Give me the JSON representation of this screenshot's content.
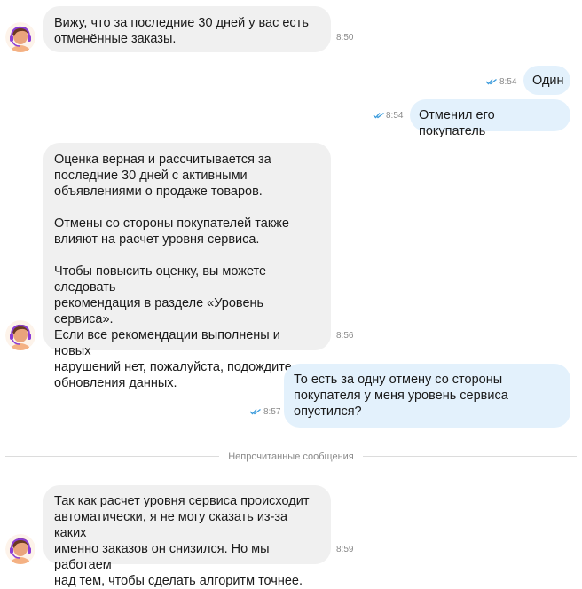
{
  "messages": [
    {
      "author": "agent",
      "text": "Вижу, что за последние 30 дней у вас есть\nотменённые заказы.",
      "time": "8:50"
    },
    {
      "author": "user",
      "text": "Один",
      "time": "8:54"
    },
    {
      "author": "user",
      "text": "Отменил его покупатель",
      "time": "8:54"
    },
    {
      "author": "agent",
      "text": "Оценка верная и рассчитывается за\nпоследние 30 дней с активными\nобъявлениями о продаже товаров.\n\nОтмены со стороны покупателей также\nвлияют на расчет уровня сервиса.\n\nЧтобы повысить оценку, вы можете следовать\nрекомендация в разделе «Уровень сервиса».\nЕсли все рекомендации выполнены и новых\nнарушений нет, пожалуйста, подождите\nобновления данных.",
      "time": "8:56"
    },
    {
      "author": "user",
      "text": "То есть за одну отмену со стороны\nпокупателя у меня уровень сервиса\nопустился?",
      "time": "8:57"
    },
    {
      "author": "agent",
      "text": "Так как расчет уровня сервиса происходит\nавтоматически, я не могу сказать из-за каких\nименно заказов он снизился. Но мы работаем\nнад тем, чтобы сделать алгоритм точнее.",
      "time": "8:59"
    }
  ],
  "divider": {
    "label": "Непрочитанные сообщения"
  },
  "colors": {
    "incoming_bubble": "#f0f0f0",
    "outgoing_bubble": "#e3f1fc",
    "read_check": "#3b9bdc",
    "time": "#8a8a8a",
    "avatar_headset": "#8b3dd6",
    "avatar_hair": "#6b3a22",
    "avatar_skin": "#e9a47c"
  },
  "icons": {
    "avatar": "support-agent-avatar",
    "read_status": "double-check-icon"
  }
}
